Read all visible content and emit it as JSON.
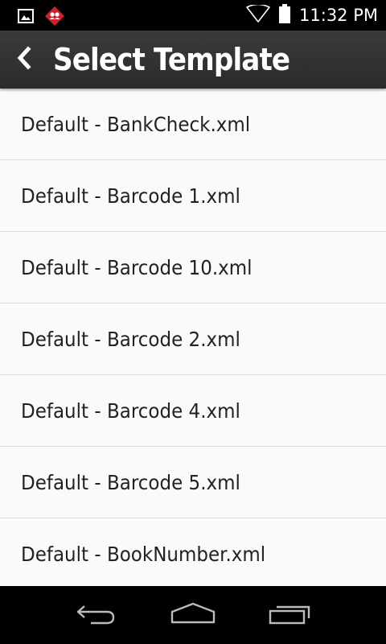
{
  "status_bar": {
    "time": "11:32 PM",
    "icons": [
      "image-notification-icon",
      "app-notification-icon",
      "wifi-icon",
      "battery-icon"
    ]
  },
  "action_bar": {
    "title": "Select Template",
    "back_icon": "chevron-left-icon"
  },
  "list": {
    "items": [
      "Default - BankCheck.xml",
      "Default - Barcode 1.xml",
      "Default - Barcode 10.xml",
      "Default - Barcode 2.xml",
      "Default - Barcode 4.xml",
      "Default - Barcode 5.xml",
      "Default - BookNumber.xml"
    ]
  },
  "nav_bar": {
    "buttons": [
      "back-nav-icon",
      "home-nav-icon",
      "recents-nav-icon"
    ]
  },
  "colors": {
    "action_bar": "#333333",
    "list_background": "#fafafa",
    "divider": "#dcdcdc",
    "text": "#222222",
    "notification_red": "#d0202a"
  }
}
